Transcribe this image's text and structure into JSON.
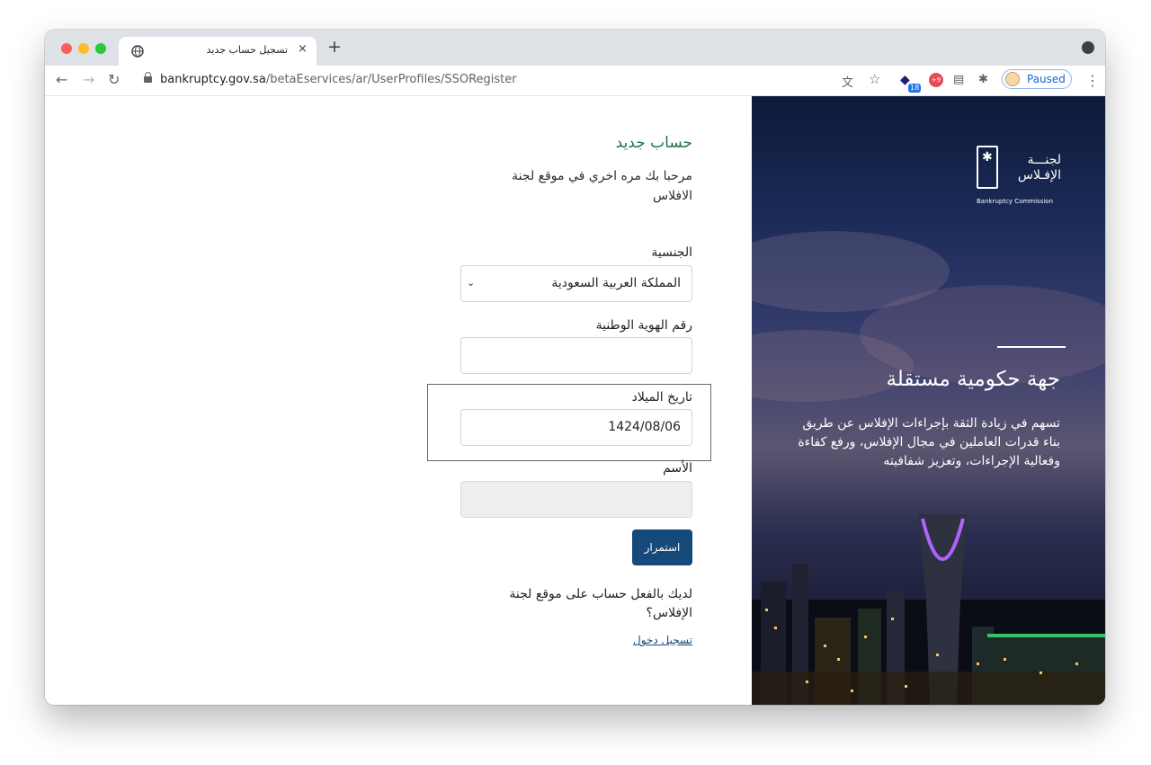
{
  "browser": {
    "tab_title": "تسجيل حساب جديد",
    "tab_close": "×",
    "new_tab": "+",
    "url_host": "bankruptcy.gov.sa",
    "url_path": "/betaEservices/ar/UserProfiles/SSORegister",
    "extension_badge": "18",
    "extension_red": "+9",
    "profile_status": "Paused",
    "icons": [
      "back-icon",
      "forward-icon",
      "reload-icon",
      "lock-icon",
      "translate-icon",
      "star-icon",
      "extension-icon",
      "puzzle-icon",
      "menu-icon"
    ]
  },
  "form": {
    "title": "حساب جديد",
    "welcome": "مرحبا بك مره اخري في موقع لجنة الافلاس",
    "nationality_label": "الجنسية",
    "nationality_value": "المملكة العربية السعودية",
    "id_label": "رقم الهوية الوطنية",
    "id_value": "",
    "dob_label": "تاريخ الميلاد",
    "dob_value": "1424/08/06",
    "name_label": "الأسم",
    "name_value": "",
    "continue_label": "استمرار",
    "have_account": "لديك بالفعل حساب على موقع لجنة الإفلاس؟",
    "login_link": "تسجيل دخول"
  },
  "hero": {
    "logo_arabic": "لجنـــة\nالإفـلاس",
    "logo_english": "Bankruptcy Commission",
    "title": "جهة حكومية مستقلة",
    "description": "تسهم في زيادة الثقة بإجراءات الإفلاس عن طريق بناء قدرات العاملين في مجال الإفلاس، ورفع كفاءة وفعالية الإجراءات، وتعزيز شفافيته"
  },
  "colors": {
    "title_green": "#1e7246",
    "button_blue": "#164a7a",
    "hero_navy": "#1b2b57"
  }
}
